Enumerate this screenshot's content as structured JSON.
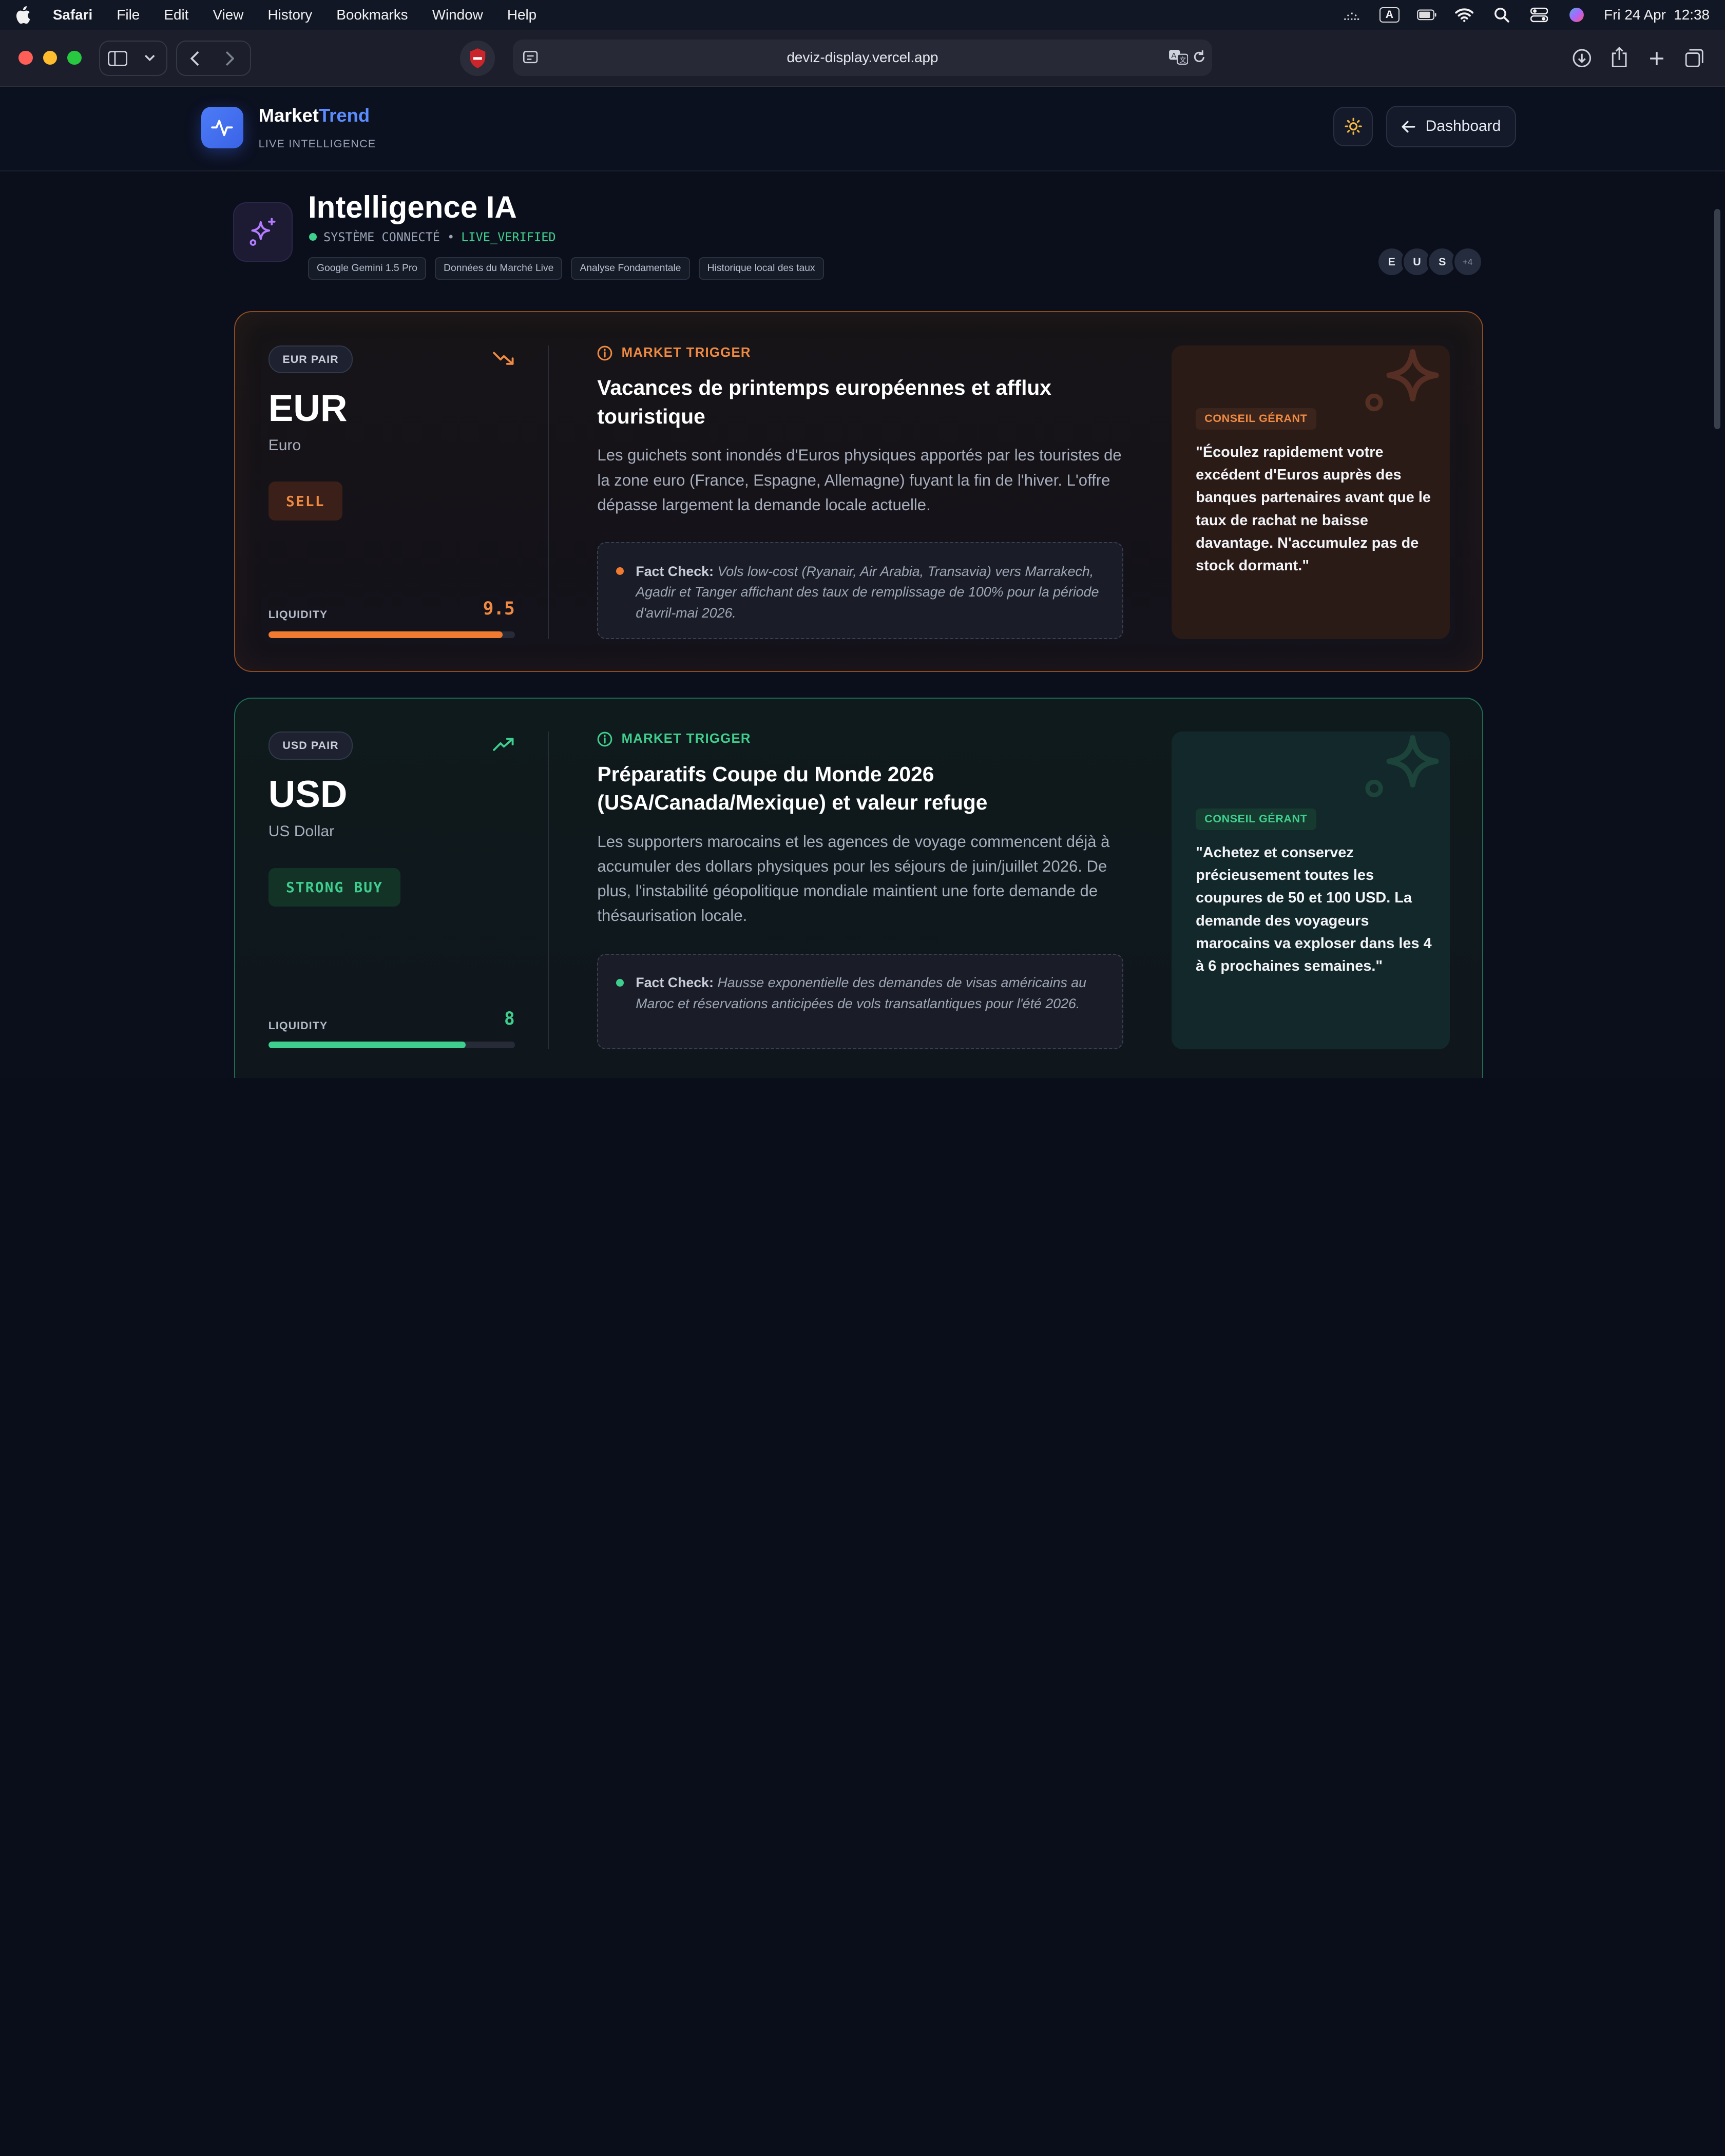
{
  "menubar": {
    "app": "Safari",
    "items": [
      "File",
      "Edit",
      "View",
      "History",
      "Bookmarks",
      "Window",
      "Help"
    ],
    "clock": "Fri 24 Apr  12:38",
    "input_source": "A"
  },
  "browser": {
    "url": "deviz-display.vercel.app"
  },
  "header": {
    "brand_main": "Market",
    "brand_accent": "Trend",
    "brand_sub": "LIVE INTELLIGENCE",
    "dashboard_label": "Dashboard"
  },
  "section": {
    "title": "Intelligence IA",
    "status_text": "SYSTÈME CONNECTÉ •",
    "status_verified": "LIVE_VERIFIED",
    "tags": [
      "Google Gemini 1.5 Pro",
      "Données du Marché Live",
      "Analyse Fondamentale",
      "Historique local des taux"
    ],
    "avatars": [
      "E",
      "U",
      "S",
      "+4"
    ]
  },
  "cards": [
    {
      "pair_label": "EUR PAIR",
      "code": "EUR",
      "name": "Euro",
      "action": "SELL",
      "liquidity_label": "LIQUIDITY",
      "liquidity": "9.5",
      "liquidity_fraction": 0.95,
      "trigger_label": "MARKET TRIGGER",
      "headline": "Vacances de printemps européennes et afflux touristique",
      "body": "Les guichets sont inondés d'Euros physiques apportés par les touristes de la zone euro (France, Espagne, Allemagne) fuyant la fin de l'hiver. L'offre dépasse largement la demande locale actuelle.",
      "fact_label": "Fact Check:",
      "fact_text": "Vols low-cost (Ryanair, Air Arabia, Transavia) vers Marrakech, Agadir et Tanger affichant des taux de remplissage de 100% pour la période d'avril-mai 2026.",
      "advice_label": "CONSEIL GÉRANT",
      "advice": "\"Écoulez rapidement votre excédent d'Euros auprès des banques partenaires avant que le taux de rachat ne baisse davantage. N'accumulez pas de stock dormant.\"",
      "accent": "#f07a30"
    },
    {
      "pair_label": "USD PAIR",
      "code": "USD",
      "name": "US Dollar",
      "action": "STRONG BUY",
      "liquidity_label": "LIQUIDITY",
      "liquidity": "8",
      "liquidity_fraction": 0.8,
      "trigger_label": "MARKET TRIGGER",
      "headline": "Préparatifs Coupe du Monde 2026 (USA/Canada/Mexique) et valeur refuge",
      "body": "Les supporters marocains et les agences de voyage commencent déjà à accumuler des dollars physiques pour les séjours de juin/juillet 2026. De plus, l'instabilité géopolitique mondiale maintient une forte demande de thésaurisation locale.",
      "fact_label": "Fact Check:",
      "fact_text": "Hausse exponentielle des demandes de visas américains au Maroc et réservations anticipées de vols transatlantiques pour l'été 2026.",
      "advice_label": "CONSEIL GÉRANT",
      "advice": "\"Achetez et conservez précieusement toutes les coupures de 50 et 100 USD. La demande des voyageurs marocains va exploser dans les 4 à 6 prochaines semaines.\"",
      "accent": "#3ecf8e"
    }
  ]
}
